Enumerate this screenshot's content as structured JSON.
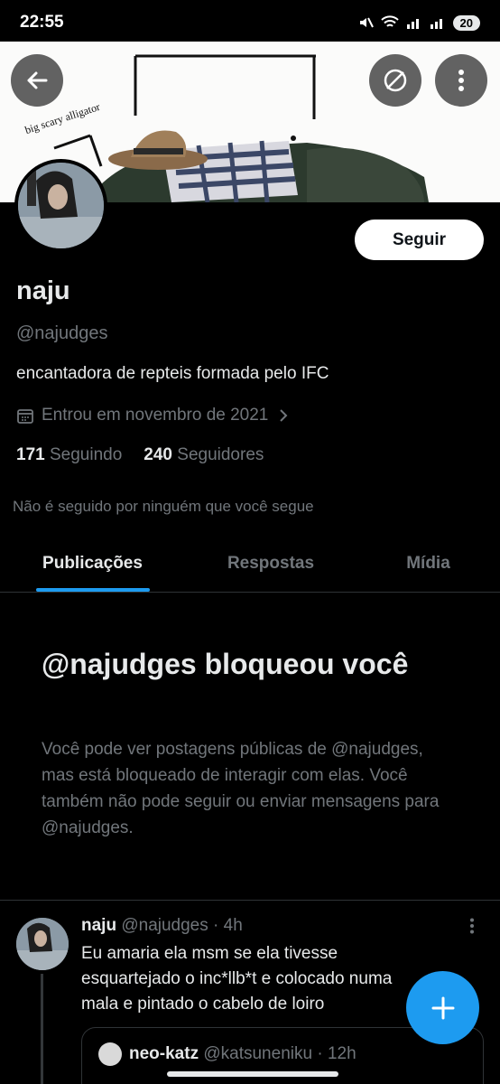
{
  "status_bar": {
    "time": "22:55",
    "battery": "20"
  },
  "banner": {
    "caption": "big scary alligator"
  },
  "profile": {
    "follow_label": "Seguir",
    "name": "naju",
    "handle": "@najudges",
    "bio": "encantadora de repteis formada pelo IFC",
    "joined": "Entrou em novembro de 2021",
    "following_count": "171",
    "following_label": "Seguindo",
    "followers_count": "240",
    "followers_label": "Seguidores",
    "not_followed": "Não é seguido por ninguém que você segue"
  },
  "tabs": [
    {
      "label": "Publicações",
      "active": true
    },
    {
      "label": "Respostas",
      "active": false
    },
    {
      "label": "Mídia",
      "active": false
    }
  ],
  "blocked": {
    "title": "@najudges bloqueou você",
    "text": "Você pode ver postagens públicas de @najudges, mas está bloqueado de interagir com elas. Você também não pode seguir ou enviar mensagens para @najudges."
  },
  "post": {
    "author": "naju",
    "handle": "@najudges",
    "time": "· 4h",
    "text": "Eu amaria ela msm se ela tivesse esquartejado o inc*llb*t e colocado numa mala e pintado o cabelo de loiro",
    "quote": {
      "author": "neo-katz",
      "handle": "@katsuneniku",
      "time": "· 12h"
    }
  },
  "colors": {
    "accent": "#1d9bf0",
    "background": "#000000",
    "secondary_text": "#71767b"
  },
  "icons": [
    "back-arrow-icon",
    "no-sign-icon",
    "more-vertical-icon",
    "calendar-icon",
    "chevron-right-icon",
    "more-vertical-icon",
    "plus-icon"
  ]
}
